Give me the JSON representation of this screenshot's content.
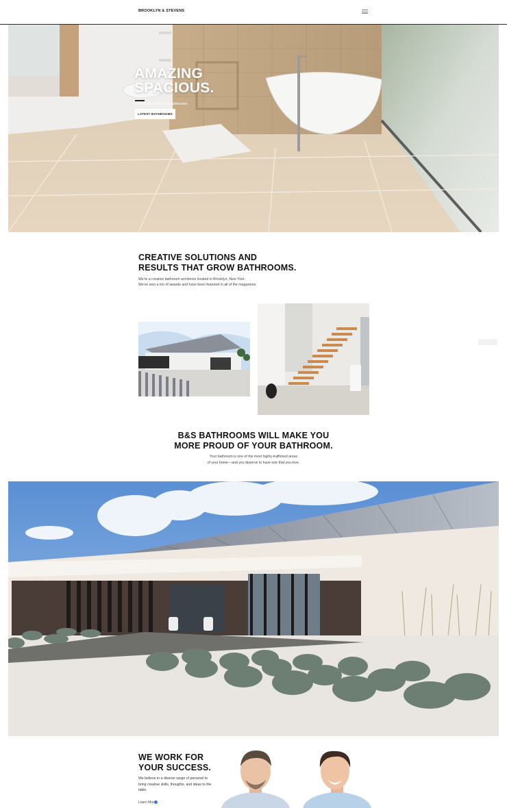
{
  "header": {
    "logo": "BROOKLYN & STEVENS"
  },
  "hero": {
    "title_line1": "AMAZING",
    "title_line2": "SPACIOUS.",
    "subtitle": "Go and discover luxury bathrooms",
    "button_label": "LATEST BATHROOMS"
  },
  "intro": {
    "title_line1": "CREATIVE SOLUTIONS AND",
    "title_line2": "RESULTS THAT GROW BATHROOMS.",
    "text_line1": "We're a creative bathroom architects located in Brooklyn, New York.",
    "text_line2": "We've won a ton of awards and have been featured in all of the magazines."
  },
  "proud": {
    "title_line1": "B&S BATHROOMS WILL MAKE YOU",
    "title_line2": "MORE PROUD OF YOUR BATHROOM.",
    "text_line1": "Your bathroom is one of the most highly-trafficked areas",
    "text_line2": "of your home—and you deserve to have one that you love."
  },
  "team": {
    "title_line1": "WE WORK FOR",
    "title_line2": "YOUR SUCCESS.",
    "text": "We believe in a diverse range of personel to bring creative skills, thoughts, and ideas to the table.",
    "link_label": "Learn More"
  },
  "colors": {
    "accent": "#2f7de1",
    "text": "#111111",
    "muted": "#444444"
  },
  "icons": {
    "menu": "hamburger-menu-icon",
    "arrow": "arrow-right-circle-icon"
  }
}
